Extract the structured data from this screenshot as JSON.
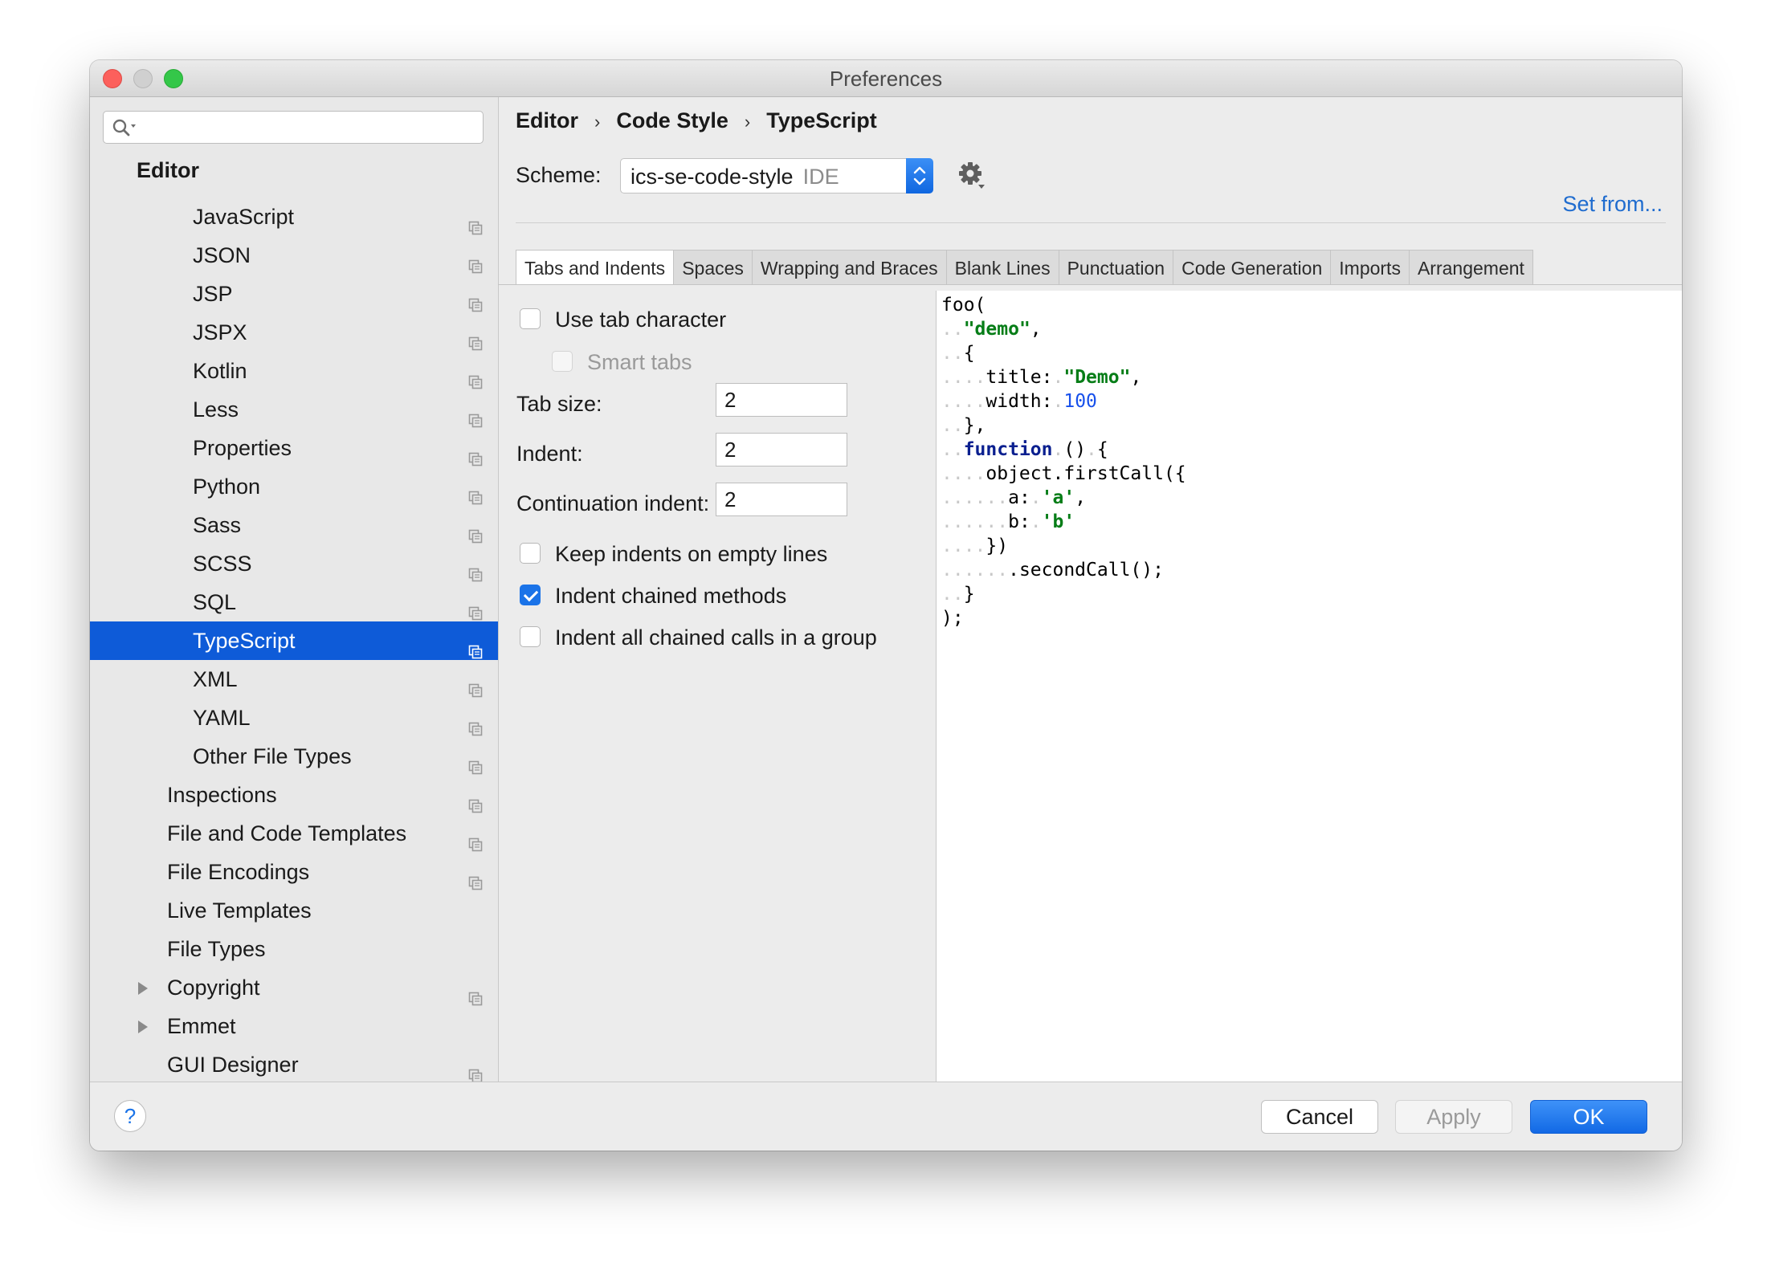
{
  "window": {
    "title": "Preferences"
  },
  "sidebar": {
    "search_placeholder": "",
    "header": "Editor",
    "items": [
      {
        "label": "JavaScript",
        "level": 2,
        "copy": true
      },
      {
        "label": "JSON",
        "level": 2,
        "copy": true
      },
      {
        "label": "JSP",
        "level": 2,
        "copy": true
      },
      {
        "label": "JSPX",
        "level": 2,
        "copy": true
      },
      {
        "label": "Kotlin",
        "level": 2,
        "copy": true
      },
      {
        "label": "Less",
        "level": 2,
        "copy": true
      },
      {
        "label": "Properties",
        "level": 2,
        "copy": true
      },
      {
        "label": "Python",
        "level": 2,
        "copy": true
      },
      {
        "label": "Sass",
        "level": 2,
        "copy": true
      },
      {
        "label": "SCSS",
        "level": 2,
        "copy": true
      },
      {
        "label": "SQL",
        "level": 2,
        "copy": true
      },
      {
        "label": "TypeScript",
        "level": 2,
        "copy": true,
        "selected": true
      },
      {
        "label": "XML",
        "level": 2,
        "copy": true
      },
      {
        "label": "YAML",
        "level": 2,
        "copy": true
      },
      {
        "label": "Other File Types",
        "level": 2,
        "copy": true
      },
      {
        "label": "Inspections",
        "level": 1,
        "copy": true
      },
      {
        "label": "File and Code Templates",
        "level": 1,
        "copy": true
      },
      {
        "label": "File Encodings",
        "level": 1,
        "copy": true
      },
      {
        "label": "Live Templates",
        "level": 1,
        "copy": false
      },
      {
        "label": "File Types",
        "level": 1,
        "copy": false
      },
      {
        "label": "Copyright",
        "level": 1,
        "copy": true,
        "expandable": true
      },
      {
        "label": "Emmet",
        "level": 1,
        "copy": false,
        "expandable": true
      },
      {
        "label": "GUI Designer",
        "level": 1,
        "copy": true
      }
    ]
  },
  "breadcrumb": [
    "Editor",
    "Code Style",
    "TypeScript"
  ],
  "scheme": {
    "label": "Scheme:",
    "name": "ics-se-code-style",
    "kind": "IDE"
  },
  "set_from": "Set from...",
  "tabs": [
    "Tabs and Indents",
    "Spaces",
    "Wrapping and Braces",
    "Blank Lines",
    "Punctuation",
    "Code Generation",
    "Imports",
    "Arrangement"
  ],
  "options": {
    "use_tab": {
      "label": "Use tab character",
      "checked": false
    },
    "smart_tabs": {
      "label": "Smart tabs",
      "checked": false,
      "disabled": true
    },
    "tab_size": {
      "label": "Tab size:",
      "value": "2"
    },
    "indent": {
      "label": "Indent:",
      "value": "2"
    },
    "continuation": {
      "label": "Continuation indent:",
      "value": "2"
    },
    "keep_indents": {
      "label": "Keep indents on empty lines",
      "checked": false
    },
    "indent_chained": {
      "label": "Indent chained methods",
      "checked": true
    },
    "indent_all_chained": {
      "label": "Indent all chained calls in a group",
      "checked": false
    }
  },
  "preview_lines": [
    [
      {
        "t": "foo("
      }
    ],
    [
      {
        "t": "..",
        "c": "ws"
      },
      {
        "t": "\"demo\"",
        "c": "str"
      },
      {
        "t": ","
      }
    ],
    [
      {
        "t": "..",
        "c": "ws"
      },
      {
        "t": "{"
      }
    ],
    [
      {
        "t": "....",
        "c": "ws"
      },
      {
        "t": "title:"
      },
      {
        "t": ".",
        "c": "ws"
      },
      {
        "t": "\"Demo\"",
        "c": "str"
      },
      {
        "t": ","
      }
    ],
    [
      {
        "t": "....",
        "c": "ws"
      },
      {
        "t": "width:"
      },
      {
        "t": ".",
        "c": "ws"
      },
      {
        "t": "100",
        "c": "num"
      }
    ],
    [
      {
        "t": "..",
        "c": "ws"
      },
      {
        "t": "},"
      }
    ],
    [
      {
        "t": "..",
        "c": "ws"
      },
      {
        "t": "function",
        "c": "kw"
      },
      {
        "t": ".",
        "c": "ws"
      },
      {
        "t": "()"
      },
      {
        "t": ".",
        "c": "ws"
      },
      {
        "t": "{"
      }
    ],
    [
      {
        "t": "....",
        "c": "ws"
      },
      {
        "t": "object.firstCall({"
      }
    ],
    [
      {
        "t": "......",
        "c": "ws"
      },
      {
        "t": "a:"
      },
      {
        "t": ".",
        "c": "ws"
      },
      {
        "t": "'a'",
        "c": "str"
      },
      {
        "t": ","
      }
    ],
    [
      {
        "t": "......",
        "c": "ws"
      },
      {
        "t": "b:"
      },
      {
        "t": ".",
        "c": "ws"
      },
      {
        "t": "'b'",
        "c": "str"
      }
    ],
    [
      {
        "t": "....",
        "c": "ws"
      },
      {
        "t": "})"
      }
    ],
    [
      {
        "t": "......",
        "c": "ws"
      },
      {
        "t": ".secondCall();"
      }
    ],
    [
      {
        "t": "..",
        "c": "ws"
      },
      {
        "t": "}"
      }
    ],
    [
      {
        "t": ");"
      }
    ]
  ],
  "buttons": {
    "help": "?",
    "cancel": "Cancel",
    "apply": "Apply",
    "ok": "OK"
  },
  "colors": {
    "accent": "#1a73e8",
    "selection": "#0e5bd8",
    "link": "#1f6ccf"
  }
}
